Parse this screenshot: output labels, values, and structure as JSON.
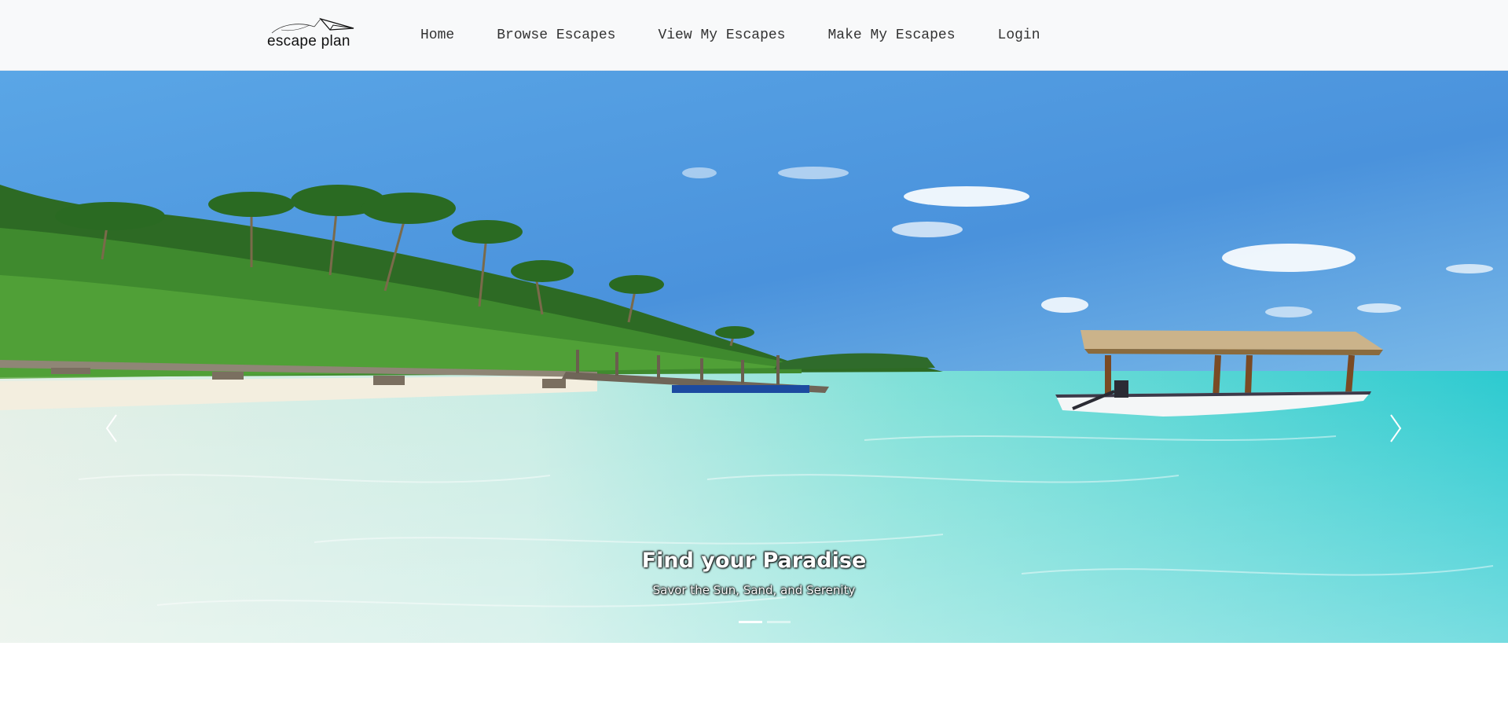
{
  "brand": {
    "name": "escape plan",
    "logo_icon": "paper-plane-icon"
  },
  "nav": {
    "items": [
      {
        "label": "Home"
      },
      {
        "label": "Browse Escapes"
      },
      {
        "label": "View My Escapes"
      },
      {
        "label": "Make My Escapes"
      },
      {
        "label": "Login"
      }
    ]
  },
  "carousel": {
    "slides": [
      {
        "title": "Find your Paradise",
        "subtitle": "Savor the Sun, Sand, and Serenity"
      }
    ],
    "prev_icon": "chevron-left-icon",
    "next_icon": "chevron-right-icon",
    "active_indicator": 1,
    "indicator_count": 2
  },
  "colors": {
    "navbar_bg": "#f8f9fa",
    "nav_text": "#333333",
    "sky": "#4f98d8",
    "sea": "#3fd4d0"
  }
}
